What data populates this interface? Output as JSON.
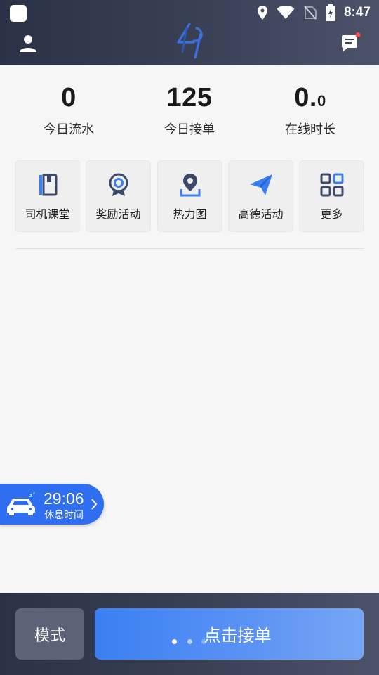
{
  "status_bar": {
    "time": "8:47",
    "icons": [
      "location-icon",
      "wifi-icon",
      "no-sim-icon",
      "battery-charging-icon"
    ]
  },
  "header": {
    "left_icon": "user-icon",
    "logo": "logo-icon",
    "right_icon": "message-icon",
    "has_notification_dot": true
  },
  "stats": [
    {
      "value": "0",
      "value_suffix": "",
      "label": "今日流水"
    },
    {
      "value": "125",
      "value_suffix": "",
      "label": "今日接单"
    },
    {
      "value": "0.",
      "value_suffix": "0",
      "label": "在线时长"
    }
  ],
  "quick_actions": [
    {
      "label": "司机课堂",
      "icon": "book-icon"
    },
    {
      "label": "奖励活动",
      "icon": "award-icon"
    },
    {
      "label": "热力图",
      "icon": "map-pin-icon"
    },
    {
      "label": "高德活动",
      "icon": "paper-plane-icon"
    },
    {
      "label": "更多",
      "icon": "grid-icon"
    }
  ],
  "rest": {
    "time": "29:06",
    "label": "休息时间",
    "icon": "sleeping-car-icon"
  },
  "bottom": {
    "mode_label": "模式",
    "accept_label": "点击接单"
  },
  "colors": {
    "header_dark": "#2b3247",
    "accent_blue": "#3a7ff2",
    "icon_navy": "#3b4a6b",
    "notification_red": "#ff4d4f"
  }
}
